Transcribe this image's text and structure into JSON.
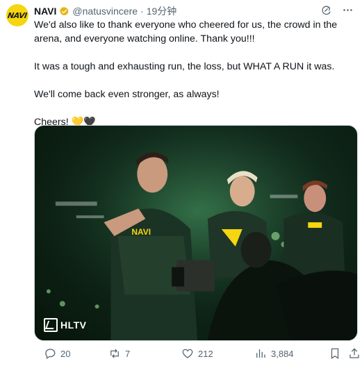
{
  "tweet": {
    "author": {
      "name": "NAVI",
      "handle": "@natusvincere",
      "separator": "·",
      "time": "19分钟",
      "avatar_text": "NAVI"
    },
    "paragraphs": [
      "We'd also like to thank everyone who cheered for us, the crowd in the arena, and everyone watching online. Thank you!!!",
      "It was a tough and exhausting run, the loss, but WHAT A RUN it was.",
      "We'll come back even stronger, as always!",
      "Cheers! 💛🖤"
    ],
    "media": {
      "watermark": "HLTV",
      "jersey_text": "NAVI"
    },
    "metrics": {
      "replies": "20",
      "reposts": "7",
      "likes": "212",
      "views": "3,884"
    },
    "icons": {
      "verified": "verified-badge-icon",
      "refresh": "grok-icon",
      "more": "more-options-icon",
      "reply": "reply-icon",
      "repost": "repost-icon",
      "like": "like-icon",
      "views": "views-icon",
      "bookmark": "bookmark-icon",
      "share": "share-icon"
    },
    "colors": {
      "brand_yellow": "#f5d60f",
      "verified_gold": "#e2b719",
      "text_primary": "#0f1419",
      "text_secondary": "#536471"
    }
  }
}
